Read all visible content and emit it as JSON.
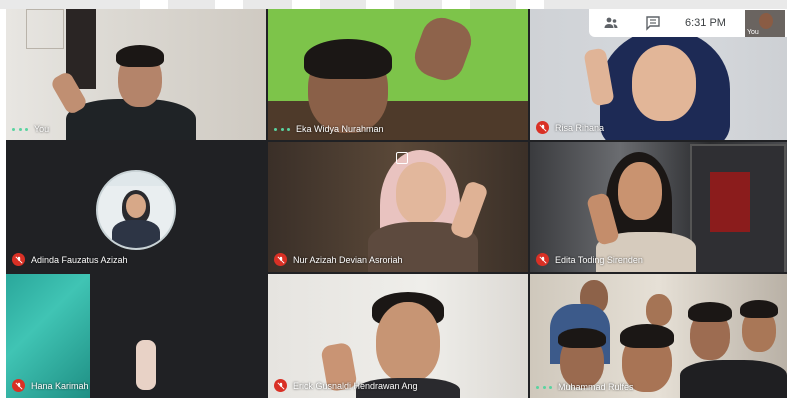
{
  "meeting": {
    "time": "6:31 PM",
    "self_thumb_label": "You"
  },
  "participants": [
    {
      "name": "You",
      "indicator": "speaking-dots"
    },
    {
      "name": "Eka Widya Nurahman",
      "indicator": "speaking-dots"
    },
    {
      "name": "Risa Rihana",
      "indicator": "muted"
    },
    {
      "name": "Adinda Fauzatus Azizah",
      "indicator": "muted"
    },
    {
      "name": "Nur Azizah Devian Asroriah",
      "indicator": "muted"
    },
    {
      "name": "Edita Toding Sirenden",
      "indicator": "muted"
    },
    {
      "name": "Hana Karimah",
      "indicator": "muted"
    },
    {
      "name": "Erick Gusnaldi Hendrawan Ang",
      "indicator": "muted"
    },
    {
      "name": "Muhammad Rulfes",
      "indicator": "speaking-dots"
    }
  ],
  "icons": {
    "people": "people-icon",
    "chat": "chat-icon",
    "speaking": "speaking-dots-icon",
    "muted": "mic-off-icon"
  },
  "colors": {
    "muted_red": "#d93025",
    "speaking_green": "#5ad3a0",
    "grid_bg": "#202124"
  }
}
